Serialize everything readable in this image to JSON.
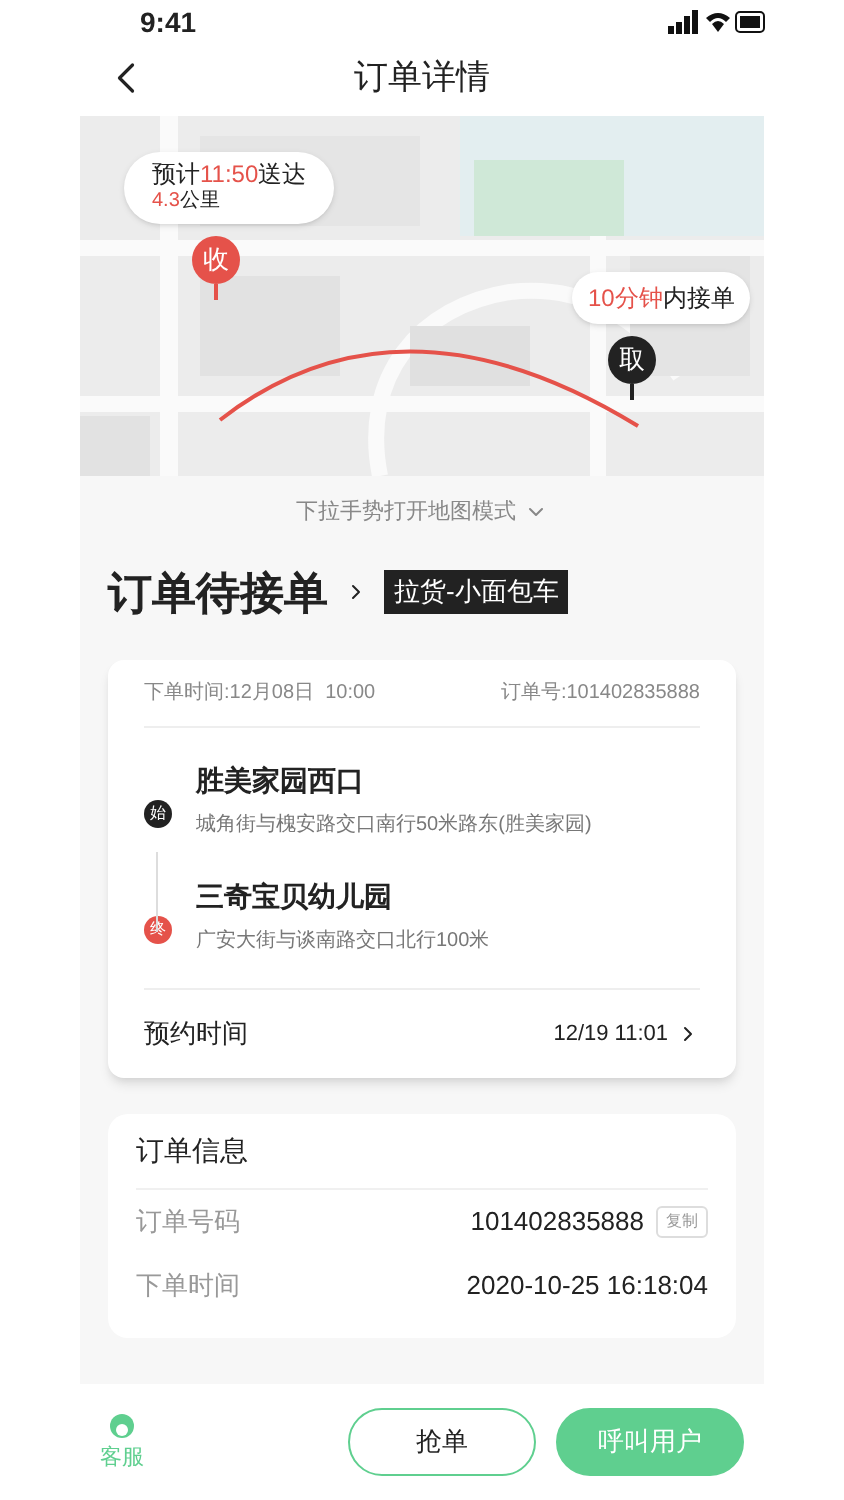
{
  "status_bar": {
    "time": "9:41"
  },
  "header": {
    "title": "订单详情"
  },
  "map": {
    "kind": "picture",
    "eta_bubble": {
      "line_1": [
        {
          "text": "预计",
          "highlight": false
        },
        {
          "text": "11:50",
          "highlight": true
        },
        {
          "text": "送达",
          "highlight": false
        }
      ],
      "line_2": [
        {
          "text": "4.3",
          "highlight": true
        },
        {
          "text": "公里",
          "highlight": false
        }
      ]
    },
    "pickup_bubble": {
      "line_1": [
        {
          "text": "10分钟",
          "highlight": true
        },
        {
          "text": "内接单",
          "highlight": false
        }
      ]
    },
    "markers": [
      {
        "kind": "dropoff",
        "label": "收"
      },
      {
        "kind": "pickup",
        "label": "取"
      }
    ]
  },
  "map_hint": "下拉手势打开地图模式",
  "order_status": {
    "title": "订单待接单",
    "tag": "拉货-小面包车"
  },
  "order_card": {
    "order_time": "下单时间:12月08日  10:00",
    "order_no": "订单号:101402835888",
    "stops": [
      {
        "kind": "start",
        "badge": "始",
        "name": "胜美家园西口",
        "address": "城角街与槐安路交口南行50米路东(胜美家园)"
      },
      {
        "kind": "end",
        "badge": "终",
        "name": "三奇宝贝幼儿园",
        "address": "广安大街与谈南路交口北行100米"
      }
    ],
    "appointment": {
      "label": "预约时间",
      "value": "12/19 11:01"
    }
  },
  "order_info": {
    "title": "订单信息",
    "rows": [
      {
        "label": "订单号码",
        "value": "101402835888",
        "action": "复制"
      },
      {
        "label": "下单时间",
        "value": "2020-10-25 16:18:04"
      }
    ]
  },
  "bottom_bar": {
    "service": "客服",
    "buttons": [
      {
        "kind": "outline",
        "label": "抢单"
      },
      {
        "kind": "filled",
        "label": "呼叫用户"
      }
    ]
  }
}
